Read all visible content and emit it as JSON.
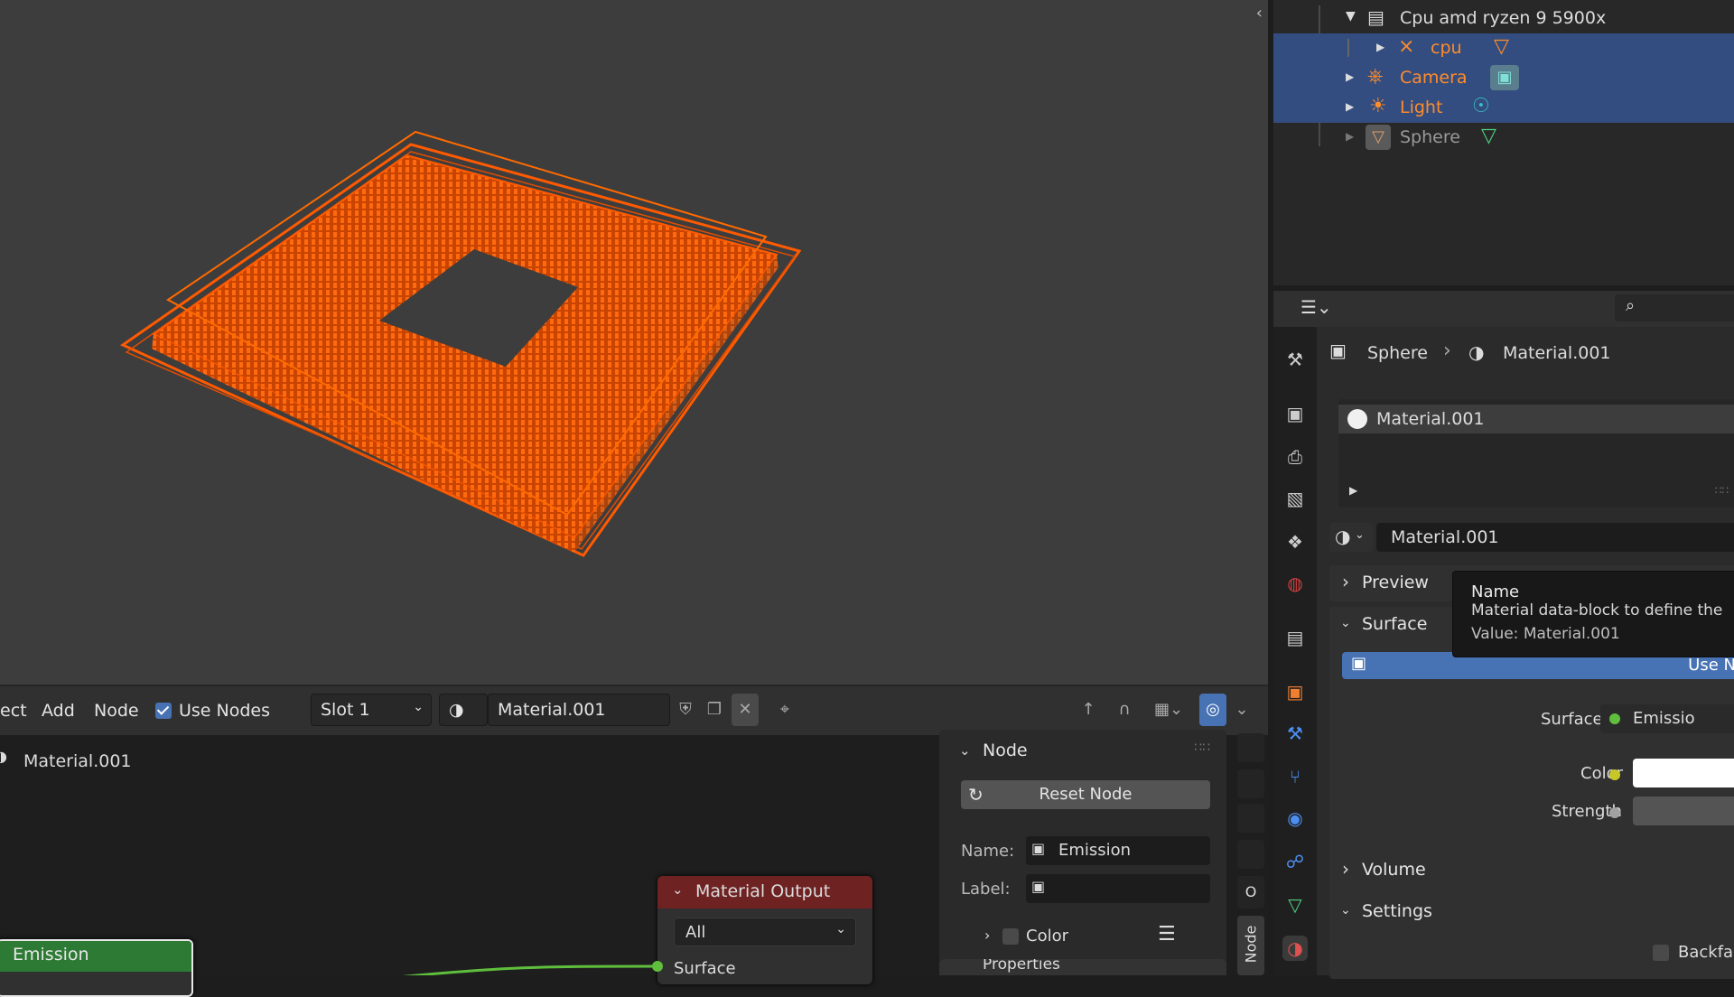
{
  "viewport": {
    "collapse_icon": "chevron-left"
  },
  "node_editor": {
    "header": {
      "menu_select": "ect",
      "menu_add": "Add",
      "menu_node": "Node",
      "use_nodes_label": "Use Nodes",
      "slot": "Slot 1",
      "material": "Material.001"
    },
    "breadcrumb": "Material.001",
    "panel": {
      "title": "Node",
      "reset_label": "Reset Node",
      "name_label": "Name:",
      "name_value": "Emission",
      "label_label": "Label:",
      "label_value": "",
      "color_label": "Color",
      "properties_label": "Properties"
    },
    "side_tab_text": "Node",
    "side_tab_letter": "O",
    "material_output": {
      "title": "Material Output",
      "target": "All",
      "socket": "Surface"
    },
    "emission_node": {
      "title": "Emission"
    }
  },
  "outliner": {
    "items": [
      {
        "label": "Cpu amd ryzen 9 5900x",
        "color": "#dcdcdc"
      },
      {
        "label": "cpu",
        "color": "#ff8c2a"
      },
      {
        "label": "Camera",
        "color": "#ff8c2a"
      },
      {
        "label": "Light",
        "color": "#ff8c2a"
      },
      {
        "label": "Sphere",
        "color": "#9a9a9a"
      }
    ]
  },
  "properties": {
    "breadcrumb_object": "Sphere",
    "breadcrumb_material": "Material.001",
    "slot_material": "Material.001",
    "datablock": "Material.001",
    "sections": {
      "preview": "Preview",
      "surface": "Surface",
      "volume": "Volume",
      "settings": "Settings"
    },
    "use_nodes_btn": "Use N",
    "surface_label": "Surface",
    "surface_value": "Emissio",
    "color_label": "Color",
    "strength_label": "Strength",
    "backface": "Backfac"
  },
  "tooltip": {
    "title": "Name",
    "desc": "Material data-block to define the ap",
    "value": "Value: Material.001"
  },
  "colors": {
    "accent": "#4772b3",
    "selection": "#334d80",
    "wire": "#ff5a00",
    "emission_header": "#2d7a35"
  }
}
